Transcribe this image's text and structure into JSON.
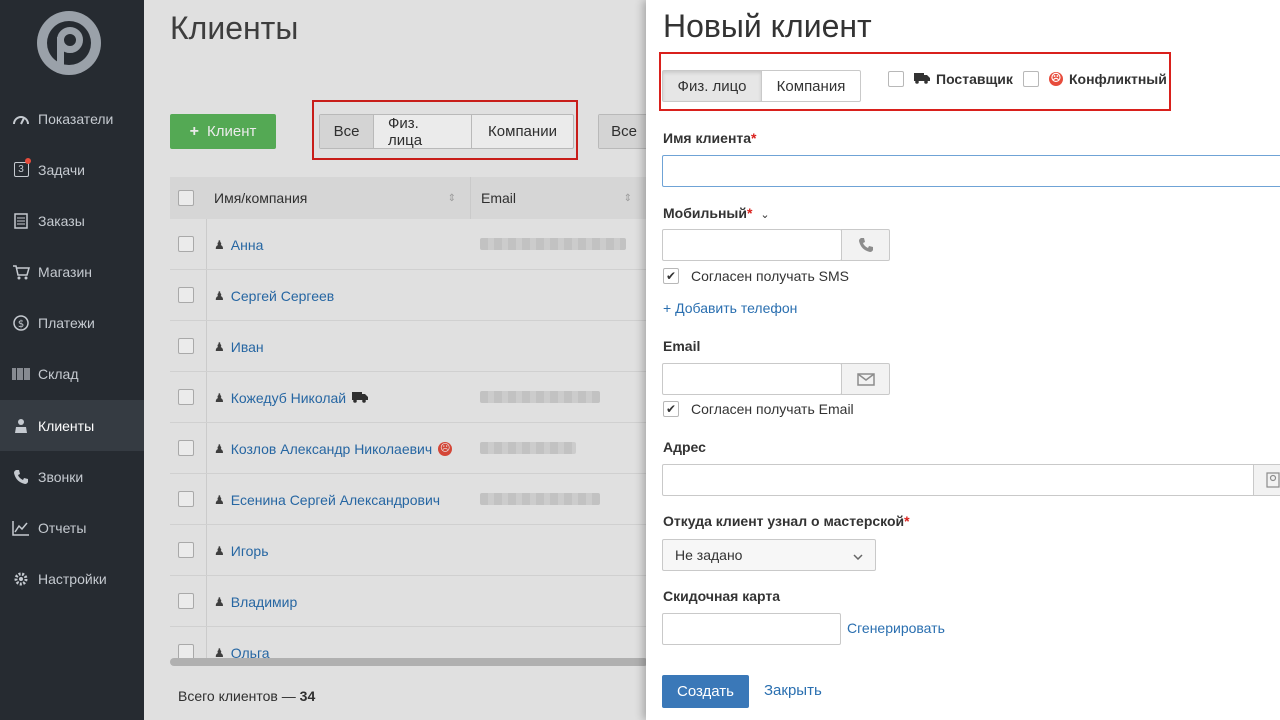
{
  "sidebar": {
    "items": [
      {
        "label": "Показатели",
        "icon": "speedometer-icon"
      },
      {
        "label": "Задачи",
        "icon": "tasks-badge-icon",
        "badge": "3"
      },
      {
        "label": "Заказы",
        "icon": "orders-icon"
      },
      {
        "label": "Магазин",
        "icon": "cart-icon"
      },
      {
        "label": "Платежи",
        "icon": "dollar-icon"
      },
      {
        "label": "Склад",
        "icon": "barcode-icon"
      },
      {
        "label": "Клиенты",
        "icon": "client-icon"
      },
      {
        "label": "Звонки",
        "icon": "phone-icon"
      },
      {
        "label": "Отчеты",
        "icon": "chart-icon"
      },
      {
        "label": "Настройки",
        "icon": "gear-icon"
      }
    ]
  },
  "main": {
    "title": "Клиенты",
    "add_button": "Клиент",
    "filter1": [
      "Все",
      "Физ. лица",
      "Компании"
    ],
    "filter2": "Все",
    "columns": [
      "Имя/компания",
      "Email"
    ],
    "rows": [
      {
        "name": "Анна"
      },
      {
        "name": "Сергей Сергеев"
      },
      {
        "name": "Иван"
      },
      {
        "name": "Кожедуб Николай"
      },
      {
        "name": "Козлов Александр Николаевич"
      },
      {
        "name": "Есенина Сергей Александрович"
      },
      {
        "name": "Игорь"
      },
      {
        "name": "Владимир"
      },
      {
        "name": "Ольга"
      }
    ],
    "total_label": "Всего клиентов — ",
    "total_value": "34"
  },
  "panel": {
    "title": "Новый клиент",
    "type_tabs": [
      "Физ. лицо",
      "Компания"
    ],
    "supplier_label": "Поставщик",
    "conflict_label": "Конфликтный",
    "name_label": "Имя клиента",
    "mobile_label": "Мобильный",
    "sms_label": "Согласен получать SMS",
    "add_phone": "+ Добавить телефон",
    "email_label": "Email",
    "email_consent": "Согласен получать Email",
    "address_label": "Адрес",
    "source_label": "Откуда клиент узнал о мастерской",
    "source_value": "Не задано",
    "discount_label": "Скидочная карта",
    "generate": "Сгенерировать",
    "create": "Создать",
    "close": "Закрыть",
    "required_mark": "*"
  },
  "colors": {
    "sidebar_bg": "#262b31",
    "primary": "#3a78b8",
    "success": "#5cb85c",
    "link": "#2a6fb0",
    "required": "#d9201c",
    "highlight_box": "#d9201c"
  }
}
